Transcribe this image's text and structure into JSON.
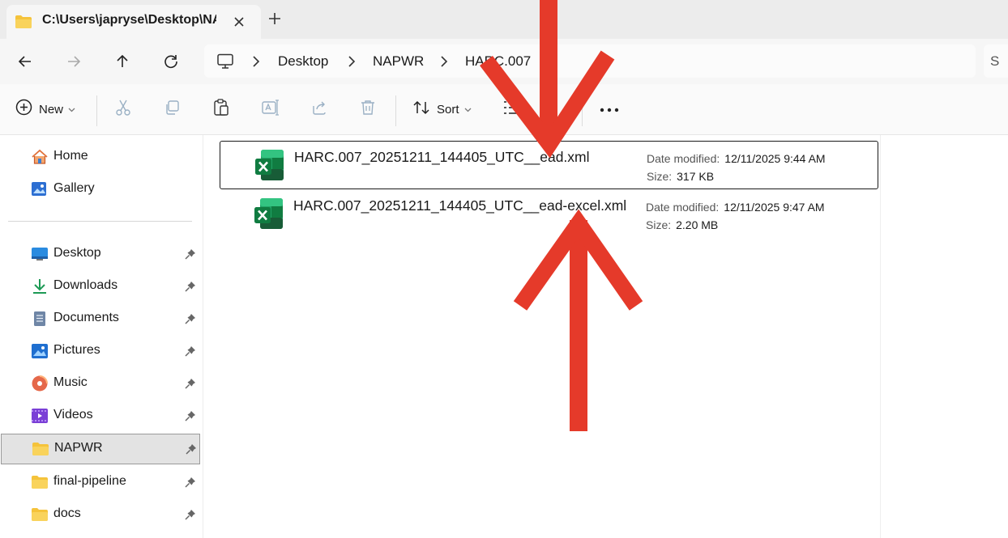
{
  "tab": {
    "title": "C:\\Users\\japryse\\Desktop\\NA"
  },
  "breadcrumb": [
    "Desktop",
    "NAPWR",
    "HARC.007"
  ],
  "search": {
    "placeholder": "S"
  },
  "toolbar": {
    "new_label": "New",
    "sort_label": "Sort"
  },
  "sidebar": {
    "top_items": [
      {
        "label": "Home",
        "icon": "home-icon"
      },
      {
        "label": "Gallery",
        "icon": "gallery-icon"
      }
    ],
    "pinned_items": [
      {
        "label": "Desktop",
        "icon": "desktop-folder-icon"
      },
      {
        "label": "Downloads",
        "icon": "downloads-icon"
      },
      {
        "label": "Documents",
        "icon": "documents-icon"
      },
      {
        "label": "Pictures",
        "icon": "pictures-icon"
      },
      {
        "label": "Music",
        "icon": "music-icon"
      },
      {
        "label": "Videos",
        "icon": "videos-icon"
      },
      {
        "label": "NAPWR",
        "icon": "folder-icon",
        "selected": true
      },
      {
        "label": "final-pipeline",
        "icon": "folder-icon"
      },
      {
        "label": "docs",
        "icon": "folder-icon"
      }
    ]
  },
  "files": [
    {
      "name": "HARC.007_20251211_144405_UTC__ead.xml",
      "date_label": "Date modified:",
      "date": "12/11/2025 9:44 AM",
      "size_label": "Size:",
      "size": "317 KB",
      "selected": true
    },
    {
      "name": "HARC.007_20251211_144405_UTC__ead-excel.xml",
      "date_label": "Date modified:",
      "date": "12/11/2025 9:47 AM",
      "size_label": "Size:",
      "size": "2.20 MB",
      "selected": false
    }
  ],
  "colors": {
    "arrow": "#e53a2a",
    "excel_green": "#1d8a4b",
    "folder_yellow": "#f5c33b"
  }
}
